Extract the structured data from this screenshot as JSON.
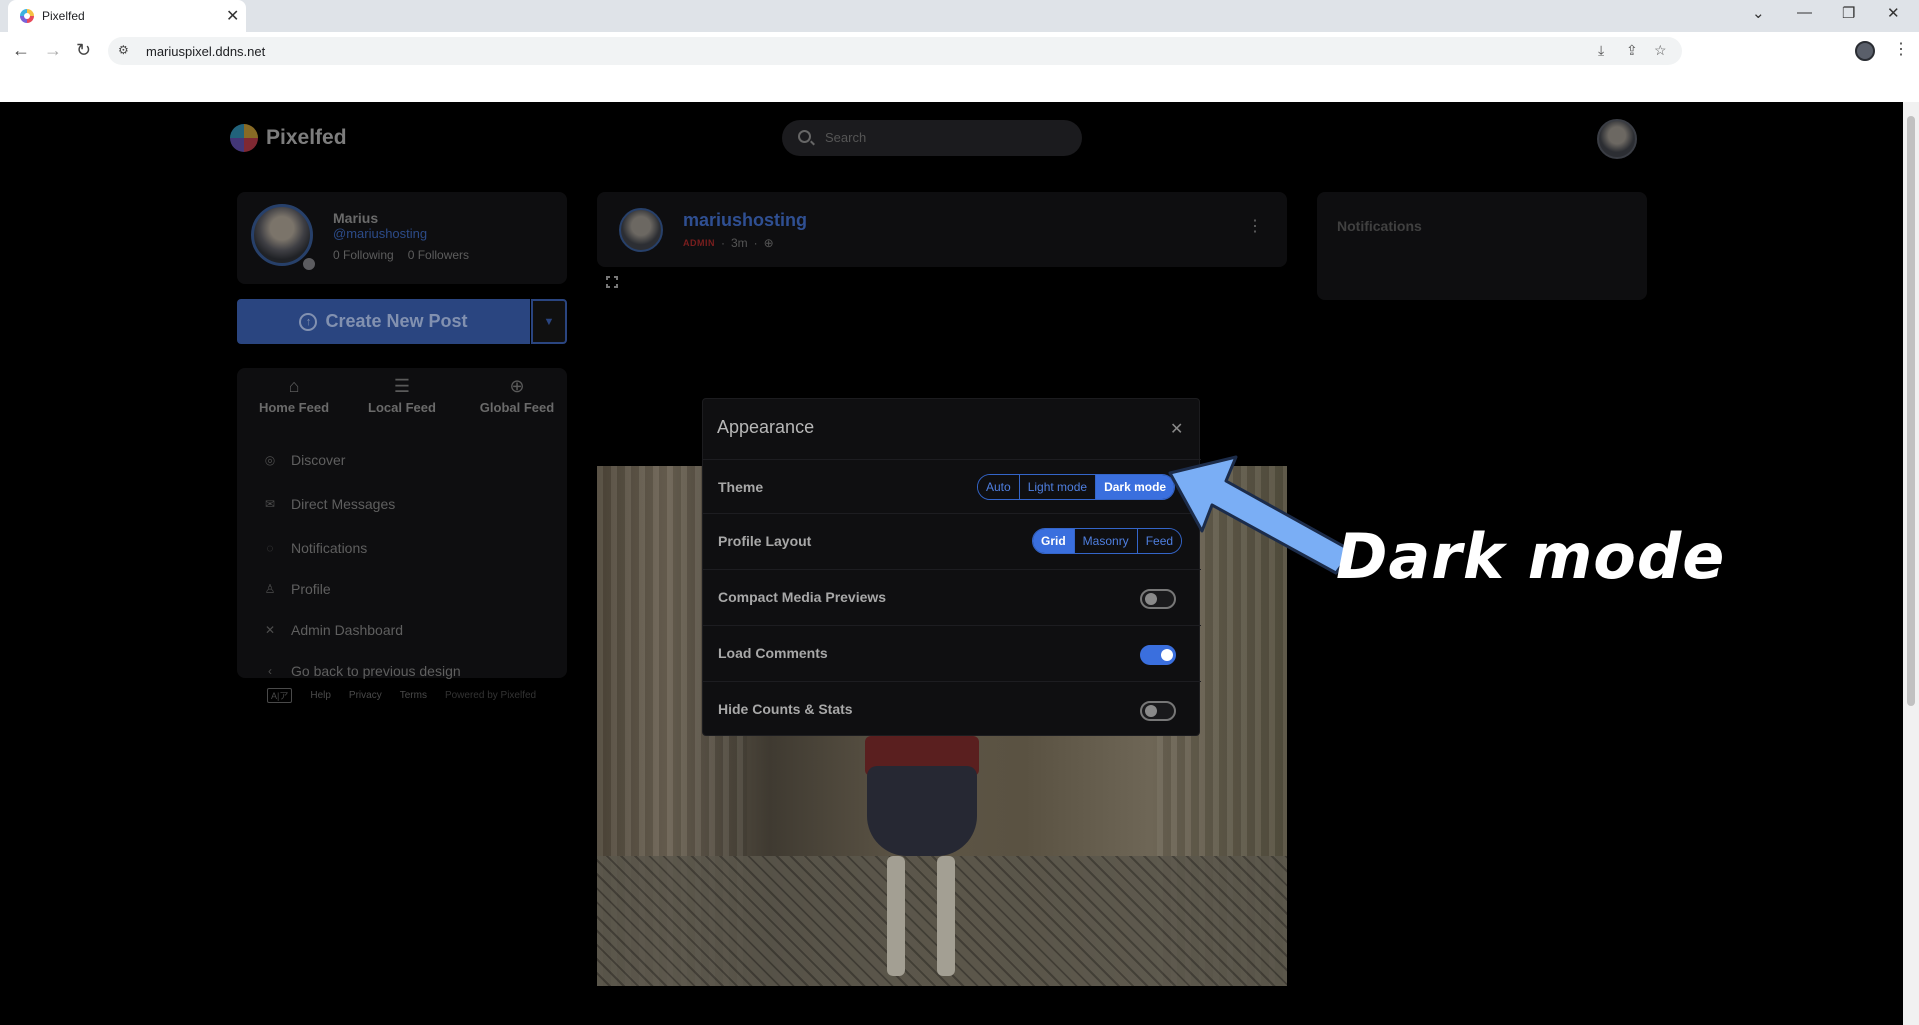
{
  "browser": {
    "tab_title": "Pixelfed",
    "url": "mariuspixel.ddns.net",
    "tab_close": "✕",
    "window_controls": [
      "⌄",
      "—",
      "❐",
      "✕"
    ]
  },
  "header": {
    "logo_text": "Pixelfed",
    "search_placeholder": "Search"
  },
  "me": {
    "name": "Marius",
    "handle": "@mariushosting",
    "following": "0 Following",
    "followers": "0 Followers"
  },
  "create": {
    "label": "Create New Post"
  },
  "feeds": [
    {
      "label": "Home Feed",
      "icon": "home-icon"
    },
    {
      "label": "Local Feed",
      "icon": "list-icon"
    },
    {
      "label": "Global Feed",
      "icon": "globe-icon"
    }
  ],
  "sidebar": {
    "items": [
      {
        "label": "Discover",
        "icon": "compass-icon"
      },
      {
        "label": "Direct Messages",
        "icon": "mail-icon"
      },
      {
        "label": "Notifications",
        "icon": "bell-icon"
      },
      {
        "label": "Profile",
        "icon": "user-icon"
      },
      {
        "label": "Admin Dashboard",
        "icon": "tools-icon"
      },
      {
        "label": "Go back to previous design",
        "icon": "chevron-left-icon"
      }
    ]
  },
  "footer": {
    "lang": "A|ア",
    "help": "Help",
    "privacy": "Privacy",
    "terms": "Terms",
    "powered": "Powered by Pixelfed"
  },
  "post": {
    "username": "mariushosting",
    "badge": "ADMIN",
    "time": "3m"
  },
  "notifications_panel": {
    "title": "Notifications"
  },
  "appearance_modal": {
    "title": "Appearance",
    "theme": {
      "label": "Theme",
      "options": [
        "Auto",
        "Light mode",
        "Dark mode"
      ],
      "selected": "Dark mode"
    },
    "profile_layout": {
      "label": "Profile Layout",
      "options": [
        "Grid",
        "Masonry",
        "Feed"
      ],
      "selected": "Grid"
    },
    "compact_media": {
      "label": "Compact Media Previews",
      "on": false
    },
    "load_comments": {
      "label": "Load Comments",
      "on": true
    },
    "hide_counts": {
      "label": "Hide Counts & Stats",
      "on": false
    }
  },
  "annotation": {
    "text": "Dark mode",
    "arrow_color": "#7aaef5"
  },
  "colors": {
    "accent": "#3a6fde",
    "link": "#2f4f92",
    "page_bg": "#000000"
  }
}
